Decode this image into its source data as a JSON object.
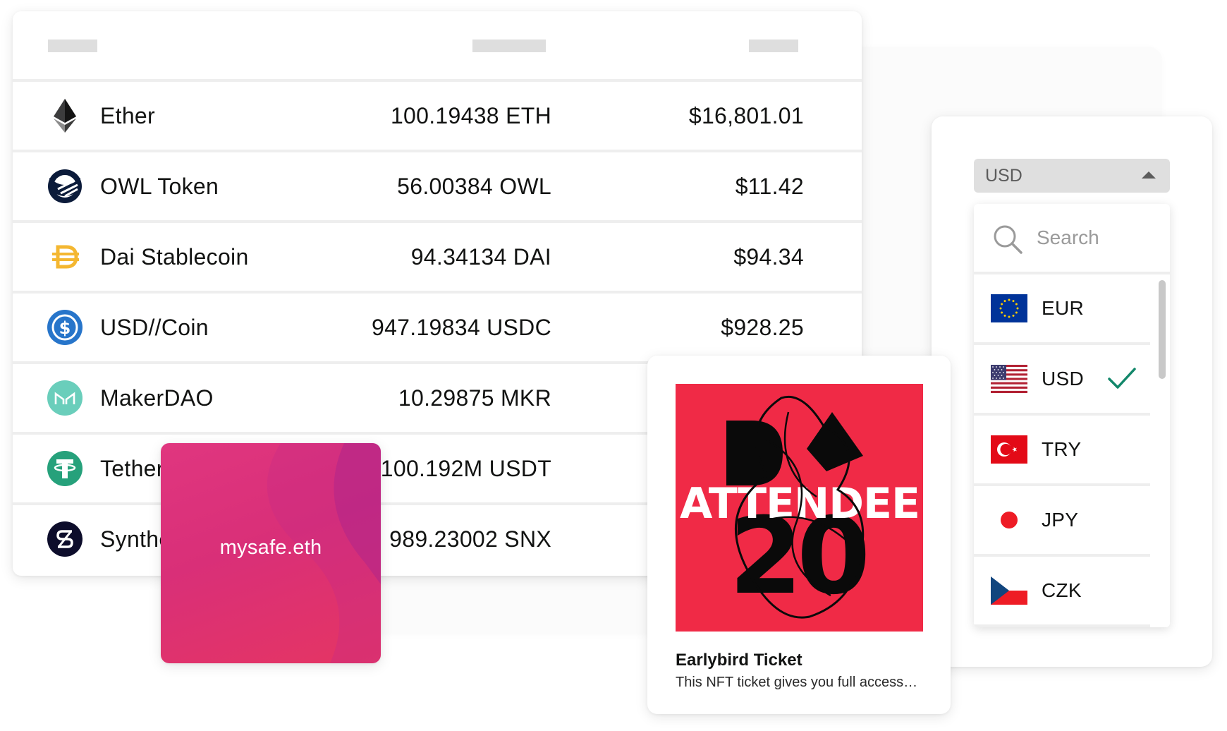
{
  "assets": [
    {
      "name": "Ether",
      "balance": "100.19438 ETH",
      "value": "$16,801.01",
      "icon": "ether-icon"
    },
    {
      "name": "OWL Token",
      "balance": "56.00384 OWL",
      "value": "$11.42",
      "icon": "owl-icon"
    },
    {
      "name": "Dai Stablecoin",
      "balance": "94.34134 DAI",
      "value": "$94.34",
      "icon": "dai-icon"
    },
    {
      "name": "USD//Coin",
      "balance": "947.19834 USDC",
      "value": "$928.25",
      "icon": "usdc-icon"
    },
    {
      "name": "MakerDAO",
      "balance": "10.29875 MKR",
      "value": "",
      "icon": "maker-icon"
    },
    {
      "name": "Tether",
      "balance": "100.192M USDT",
      "value": "",
      "icon": "tether-icon"
    },
    {
      "name": "Synthetix",
      "balance": "989.23002 SNX",
      "value": "",
      "icon": "synthetix-icon"
    }
  ],
  "currency": {
    "selected": "USD",
    "search_placeholder": "Search",
    "options": [
      {
        "code": "EUR",
        "flag": "eu-flag-icon",
        "checked": false
      },
      {
        "code": "USD",
        "flag": "us-flag-icon",
        "checked": true
      },
      {
        "code": "TRY",
        "flag": "tr-flag-icon",
        "checked": false
      },
      {
        "code": "JPY",
        "flag": "jp-flag-icon",
        "checked": false
      },
      {
        "code": "CZK",
        "flag": "cz-flag-icon",
        "checked": false
      }
    ]
  },
  "safe": {
    "name": "mysafe.eth"
  },
  "nft": {
    "title": "Earlybird Ticket",
    "description": "This NFT ticket gives you full access…",
    "artwork_text": "ATTENDEE",
    "artwork_number": "20"
  },
  "colors": {
    "check": "#12876a",
    "nft_background": "#f02a46",
    "safe_gradient_start": "#e0367f",
    "safe_gradient_end": "#e53563",
    "row_divider": "#eeeeee"
  }
}
